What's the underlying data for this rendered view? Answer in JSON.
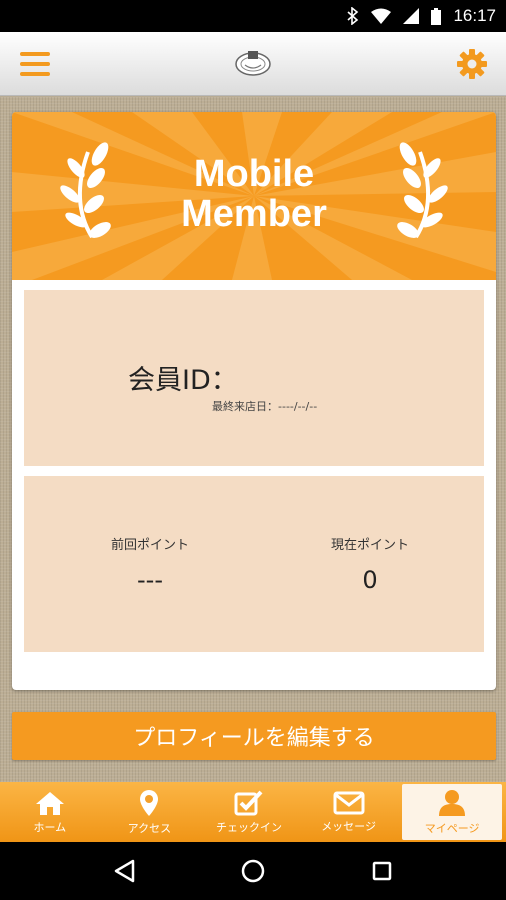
{
  "status": {
    "time": "16:17"
  },
  "banner": {
    "line1": "Mobile",
    "line2": "Member"
  },
  "member": {
    "id_label": "会員ID：",
    "last_visit": "最終来店日：----/--/--"
  },
  "points": {
    "previous_label": "前回ポイント",
    "previous_value": "---",
    "current_label": "現在ポイント",
    "current_value": "0"
  },
  "edit_button": "プロフィールを編集する",
  "tabs": [
    {
      "label": "ホーム",
      "icon": "home-icon"
    },
    {
      "label": "アクセス",
      "icon": "map-pin-icon"
    },
    {
      "label": "チェックイン",
      "icon": "checkbox-icon"
    },
    {
      "label": "メッセージ",
      "icon": "mail-icon"
    },
    {
      "label": "マイページ",
      "icon": "person-icon"
    }
  ],
  "colors": {
    "accent": "#f59a20",
    "panel": "#f4dcc4"
  }
}
